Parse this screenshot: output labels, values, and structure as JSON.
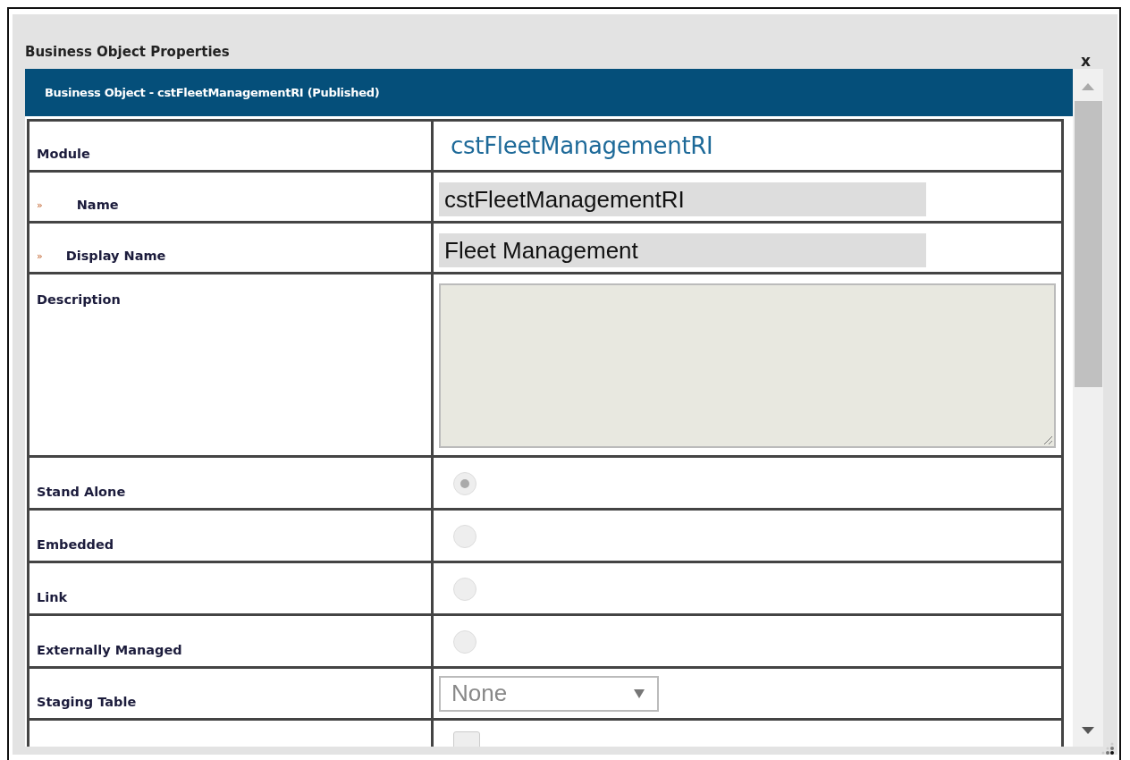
{
  "dialog": {
    "title": "Business Object Properties",
    "close": "x"
  },
  "panel": {
    "header": "Business Object - cstFleetManagementRI (Published)"
  },
  "rows": [
    {
      "kind": "text",
      "label": "Module",
      "value": "cstFleetManagementRI"
    },
    {
      "kind": "input",
      "marker": "»",
      "label": "Name",
      "value": "cstFleetManagementRI"
    },
    {
      "kind": "input",
      "marker": "»",
      "label": "Display Name",
      "value": "Fleet Management"
    },
    {
      "kind": "textarea",
      "label": "Description"
    },
    {
      "kind": "radio",
      "label": "Stand Alone",
      "selected": true
    },
    {
      "kind": "radio",
      "label": "Embedded",
      "selected": false
    },
    {
      "kind": "radio",
      "label": "Link",
      "selected": false
    },
    {
      "kind": "radio",
      "label": "Externally Managed",
      "selected": false
    },
    {
      "kind": "select",
      "label": "Staging Table",
      "value": "None"
    },
    {
      "kind": "checkbox",
      "checked": false
    }
  ]
}
